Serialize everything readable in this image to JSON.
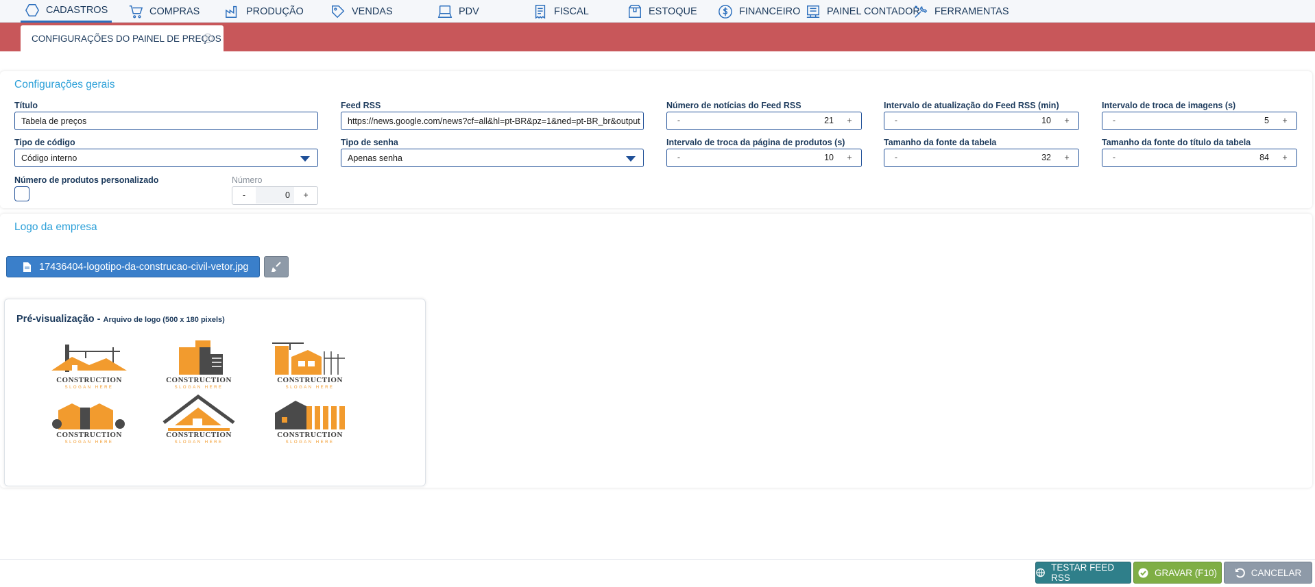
{
  "menu": [
    {
      "label": "CADASTROS",
      "icon": "hexagon-icon",
      "active": true
    },
    {
      "label": "COMPRAS",
      "icon": "cart-icon"
    },
    {
      "label": "PRODUÇÃO",
      "icon": "factory-icon"
    },
    {
      "label": "VENDAS",
      "icon": "tag-icon"
    },
    {
      "label": "PDV",
      "icon": "pos-terminal-icon"
    },
    {
      "label": "FISCAL",
      "icon": "receipt-icon"
    },
    {
      "label": "ESTOQUE",
      "icon": "box-icon"
    },
    {
      "label": "FINANCEIRO",
      "icon": "dollar-icon"
    },
    {
      "label": "PAINEL CONTADOR",
      "icon": "ledger-icon"
    },
    {
      "label": "FERRAMENTAS",
      "icon": "tools-icon"
    }
  ],
  "tab": {
    "label": "CONFIGURAÇÕES DO PAINEL DE PREÇOS",
    "close": "⊗"
  },
  "general": {
    "title": "Configurações gerais",
    "titulo": {
      "label": "Título",
      "value": "Tabela de preços"
    },
    "feed_rss": {
      "label": "Feed RSS",
      "value": "https://news.google.com/news?cf=all&hl=pt-BR&pz=1&ned=pt-BR_br&output"
    },
    "num_noticias": {
      "label": "Número de notícias do Feed RSS",
      "value": "21"
    },
    "intervalo_rss": {
      "label": "Intervalo de atualização do Feed RSS (min)",
      "value": "10"
    },
    "intervalo_imagens": {
      "label": "Intervalo de troca de imagens (s)",
      "value": "5"
    },
    "tipo_codigo": {
      "label": "Tipo de código",
      "value": "Código interno"
    },
    "tipo_senha": {
      "label": "Tipo de senha",
      "value": "Apenas senha"
    },
    "intervalo_pagina": {
      "label": "Intervalo de troca da página de produtos (s)",
      "value": "10"
    },
    "fonte_tabela": {
      "label": "Tamanho da fonte da tabela",
      "value": "32"
    },
    "fonte_titulo": {
      "label": "Tamanho da fonte do título da tabela",
      "value": "84"
    },
    "num_personalizado": {
      "label": "Número de produtos personalizado",
      "checked": false
    },
    "numero": {
      "label": "Número",
      "value": "0"
    },
    "minus": "-",
    "plus": "+"
  },
  "logo": {
    "title": "Logo da empresa",
    "file_name": "17436404-logotipo-da-construcao-civil-vetor.jpg",
    "preview_title": "Pré-visualização -",
    "preview_subtitle": "Arquivo de logo (500 x 180 pixels)",
    "logo_word": "CONSTRUCTION",
    "logo_slogan": "SLOGAN HERE",
    "orange": "#f29b2e",
    "dark": "#4a4a4a"
  },
  "actions": {
    "test_rss": "TESTAR FEED RSS",
    "save": "GRAVAR (F10)",
    "cancel": "CANCELAR"
  }
}
